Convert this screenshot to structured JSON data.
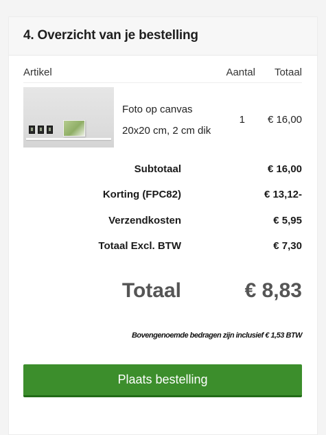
{
  "section": {
    "title": "4. Overzicht van je bestelling"
  },
  "table": {
    "headers": [
      "Artikel",
      "Aantal",
      "Totaal"
    ],
    "items": [
      {
        "name": "Foto op canvas",
        "size": "20x20 cm, 2 cm dik",
        "quantity": "1",
        "total": "€ 16,00"
      }
    ]
  },
  "summary": [
    {
      "label": "Subtotaal",
      "value": "€ 16,00"
    },
    {
      "label": "Korting (FPC82)",
      "value": "€ 13,12-"
    },
    {
      "label": "Verzendkosten",
      "value": "€ 5,95"
    },
    {
      "label": "Totaal Excl. BTW",
      "value": "€ 7,30"
    }
  ],
  "grand_total": {
    "label": "Totaal",
    "value": "€ 8,83"
  },
  "vat_note": "Bovengenoemde bedragen zijn inclusief € 1,53 BTW",
  "order_button": {
    "label": "Plaats bestelling",
    "color": "#3c8e2c"
  }
}
